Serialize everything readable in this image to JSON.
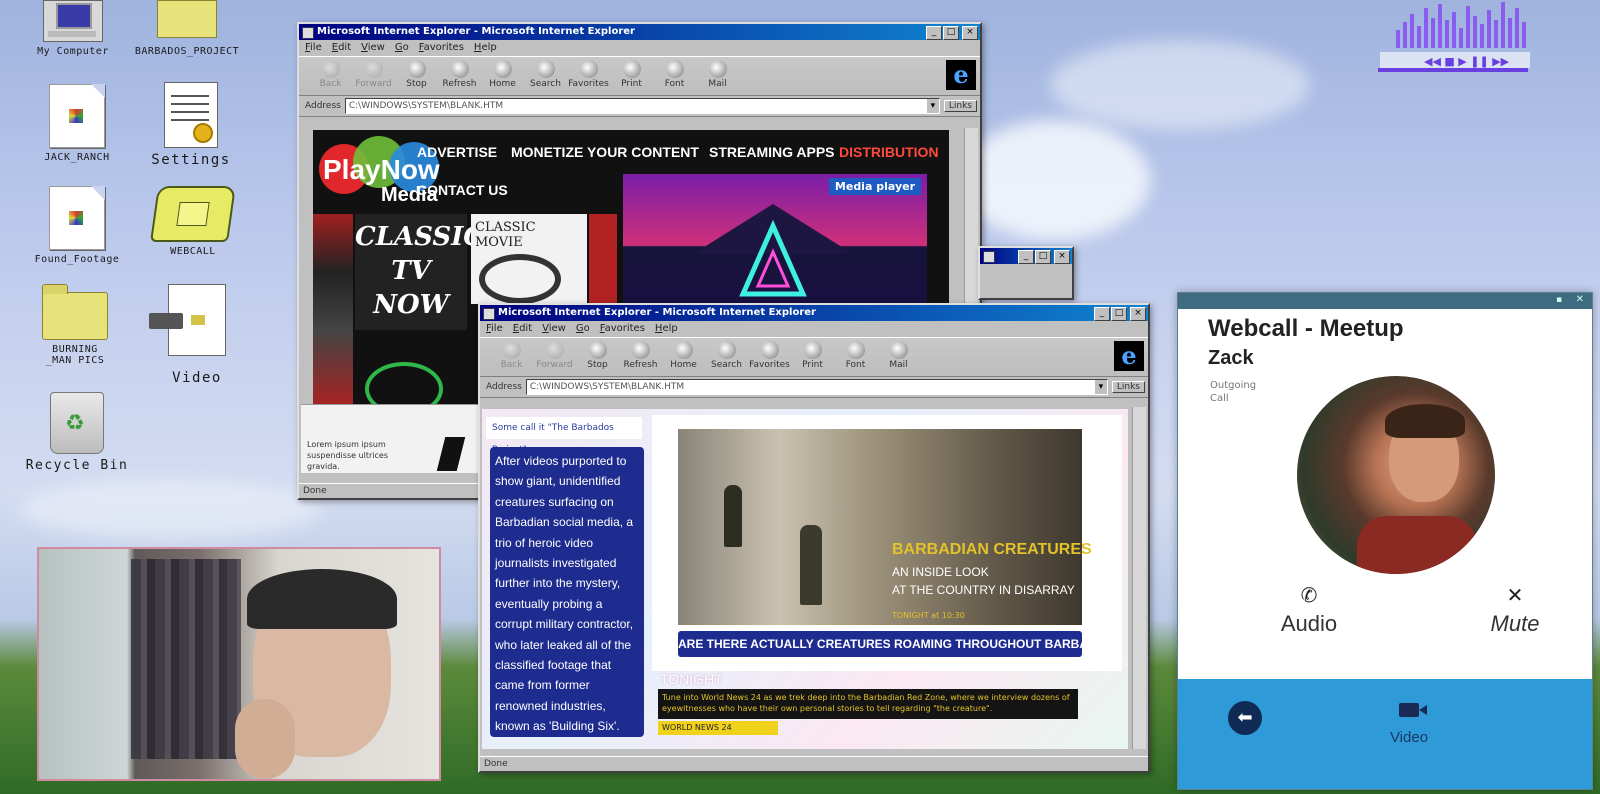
{
  "desktop": {
    "icons": [
      {
        "label": "My Computer"
      },
      {
        "label": "BARBADOS_PROJECT"
      },
      {
        "label": "JACK_RANCH"
      },
      {
        "label": "Settings"
      },
      {
        "label": "Found_Footage"
      },
      {
        "label": "WEBCALL"
      },
      {
        "label": "BURNING _MAN PICS"
      },
      {
        "label": "Video"
      },
      {
        "label": "Recycle Bin"
      }
    ]
  },
  "browser_back": {
    "title": "Microsoft Internet Explorer - Microsoft Internet Explorer",
    "menu": [
      "File",
      "Edit",
      "View",
      "Go",
      "Favorites",
      "Help"
    ],
    "tools": [
      "Back",
      "Forward",
      "Stop",
      "Refresh",
      "Home",
      "Search",
      "Favorites",
      "Print",
      "Font",
      "Mail"
    ],
    "address_label": "Address",
    "address": "C:\\WINDOWS\\SYSTEM\\BLANK.HTM",
    "links_label": "Links",
    "status": "Done",
    "page": {
      "logo_play": "PlayNow",
      "logo_media": "Media",
      "nav": [
        "ADVERTISE",
        "MONETIZE YOUR CONTENT",
        "STREAMING APPS",
        "DISTRIBUTION",
        "CONTACT US"
      ],
      "media_player": "Media player",
      "classic_tv": "CLASSIC TV NOW",
      "classic_movie": "CLASSIC MOVIE",
      "footer_text": "Lorem ipsum ipsum suspendisse ultrices gravida."
    }
  },
  "browser_front": {
    "title": "Microsoft Internet Explorer - Microsoft Internet Explorer",
    "menu": [
      "File",
      "Edit",
      "View",
      "Go",
      "Favorites",
      "Help"
    ],
    "tools": [
      "Back",
      "Forward",
      "Stop",
      "Refresh",
      "Home",
      "Search",
      "Favorites",
      "Print",
      "Font",
      "Mail"
    ],
    "address_label": "Address",
    "address": "C:\\WINDOWS\\SYSTEM\\BLANK.HTM",
    "links_label": "Links",
    "status": "Done",
    "page": {
      "tagline": "Some call it \"The Barbados Project\"",
      "story": "After videos purported to show giant, unidentified creatures surfacing on Barbadian social media, a trio of heroic video journalists investigated further into the mystery, eventually probing a corrupt military contractor, who later leaked all of the classified footage that came from former renowned industries, known as 'Building Six'.",
      "video_headline": "BARBADIAN CREATURES",
      "video_sub1": "AN INSIDE LOOK",
      "video_sub2": "AT THE COUNTRY IN DISARRAY",
      "video_time": "TONIGHT at 10:30",
      "question": "ARE THERE ACTUALLY CREATURES ROAMING THROUGHOUT BARBADOS?",
      "tonight": "TONIGHT",
      "tonight_text": "Tune into World News 24 as we trek deep into the Barbadian Red Zone, where we interview dozens of eyewitnesses who have their own personal stories to tell regarding \"the creature\".",
      "network": "WORLD NEWS 24"
    }
  },
  "webcall": {
    "title": "Webcall - Meetup",
    "caller": "Zack",
    "status": "Outgoing Call",
    "audio": "Audio",
    "mute": "Mute",
    "video": "Video"
  }
}
